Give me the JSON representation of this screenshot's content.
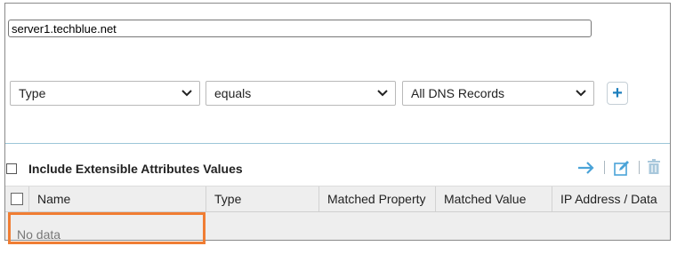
{
  "search": {
    "value": "server1.techblue.net"
  },
  "filters": {
    "field": "Type",
    "operator": "equals",
    "record_type": "All DNS Records",
    "add_icon": "plus-icon"
  },
  "options": {
    "include_extensible_label": "Include Extensible Attributes Values"
  },
  "toolbar": {
    "icons": [
      "arrow-right-icon",
      "edit-icon",
      "trash-icon"
    ]
  },
  "table": {
    "columns": [
      "Name",
      "Type",
      "Matched Property",
      "Matched Value",
      "IP Address / Data"
    ],
    "empty_text": "No data"
  },
  "colors": {
    "accent": "#1d7fbd",
    "highlight": "#f07d33"
  }
}
